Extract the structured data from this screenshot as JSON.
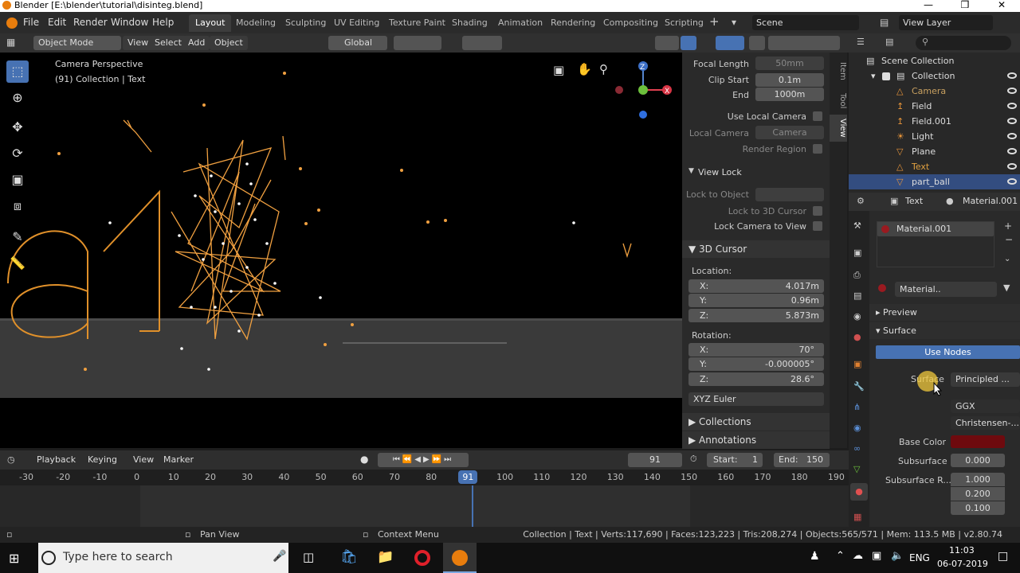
{
  "window": {
    "title": "Blender [E:\\blender\\tutorial\\disinteg.blend]",
    "minimize": "—",
    "restore": "❒",
    "close": "✕"
  },
  "menu": [
    "File",
    "Edit",
    "Render",
    "Window",
    "Help"
  ],
  "workspaces": [
    {
      "label": "Layout",
      "active": true
    },
    {
      "label": "Modeling"
    },
    {
      "label": "Sculpting"
    },
    {
      "label": "UV Editing"
    },
    {
      "label": "Texture Paint"
    },
    {
      "label": "Shading"
    },
    {
      "label": "Animation"
    },
    {
      "label": "Rendering"
    },
    {
      "label": "Compositing"
    },
    {
      "label": "Scripting"
    }
  ],
  "scene": {
    "label": "Scene",
    "view_layer": "View Layer"
  },
  "viewport_header": {
    "mode": "Object Mode",
    "view": "View",
    "select": "Select",
    "add": "Add",
    "object": "Object",
    "orientation": "Global"
  },
  "viewport": {
    "camera_label": "Camera Perspective",
    "collection_label": "(91) Collection | Text"
  },
  "npanel": {
    "focal_length_label": "Focal Length",
    "focal_length": "50mm",
    "clip_start_label": "Clip Start",
    "clip_start": "0.1m",
    "end_label": "End",
    "end": "1000m",
    "use_local_camera": "Use Local Camera",
    "local_camera_label": "Local Camera",
    "local_camera": "Camera",
    "render_region": "Render Region",
    "view_lock": "View Lock",
    "lock_to_object": "Lock to Object",
    "lock_to_3d_cursor": "Lock to 3D Cursor",
    "lock_camera_to_view": "Lock Camera to View",
    "cursor_section": "3D Cursor",
    "location_label": "Location:",
    "loc_x": "4.017m",
    "loc_y": "0.96m",
    "loc_z": "5.873m",
    "rotation_label": "Rotation:",
    "rot_x": "70°",
    "rot_y": "-0.000005°",
    "rot_z": "28.6°",
    "rotation_mode": "XYZ Euler",
    "collections": "Collections",
    "annotations": "Annotations",
    "x": "X:",
    "y": "Y:",
    "z": "Z:",
    "tabs": [
      "Item",
      "Tool",
      "View"
    ]
  },
  "timeline": {
    "playback": "Playback",
    "keying": "Keying",
    "view": "View",
    "marker": "Marker",
    "current_frame": "91",
    "start_label": "Start:",
    "start": "1",
    "end_label": "End:",
    "end": "150",
    "ruler": [
      "-30",
      "-20",
      "-10",
      "0",
      "10",
      "20",
      "30",
      "40",
      "50",
      "60",
      "70",
      "80",
      "91",
      "100",
      "110",
      "120",
      "130",
      "140",
      "150",
      "160",
      "170",
      "180",
      "190"
    ]
  },
  "status": {
    "pan_view": "Pan View",
    "context_menu": "Context Menu",
    "stats": "Collection | Text | Verts:117,690 | Faces:123,223 | Tris:208,274 | Objects:565/571 | Mem: 113.5 MB | v2.80.74"
  },
  "outliner": {
    "root": "Scene Collection",
    "collection": "Collection",
    "items": [
      {
        "label": "Camera",
        "color": "#c8a060"
      },
      {
        "label": "Field",
        "color": "#ddd"
      },
      {
        "label": "Field.001",
        "color": "#ddd"
      },
      {
        "label": "Light",
        "color": "#ddd"
      },
      {
        "label": "Plane",
        "color": "#ddd"
      },
      {
        "label": "Text",
        "color": "#e0a040"
      },
      {
        "label": "part_ball",
        "color": "#ddd"
      }
    ]
  },
  "properties": {
    "object": "Text",
    "material": "Material.001",
    "slot": "Material.001",
    "material_short": "Material..",
    "preview": "Preview",
    "surface_section": "Surface",
    "use_nodes": "Use Nodes",
    "surface_label": "Surface",
    "surface_value": "Principled ...",
    "distribution": "GGX",
    "subsurface_method": "Christensen-...",
    "base_color_label": "Base Color",
    "base_color": "#6e0a0e",
    "subsurface_label": "Subsurface",
    "subsurface": "0.000",
    "subsurface_r_label": "Subsurface R...",
    "sr1": "1.000",
    "sr2": "0.200",
    "sr3": "0.100"
  },
  "taskbar": {
    "search_placeholder": "Type here to search",
    "lang": "ENG",
    "time": "11:03",
    "date": "06-07-2019"
  }
}
